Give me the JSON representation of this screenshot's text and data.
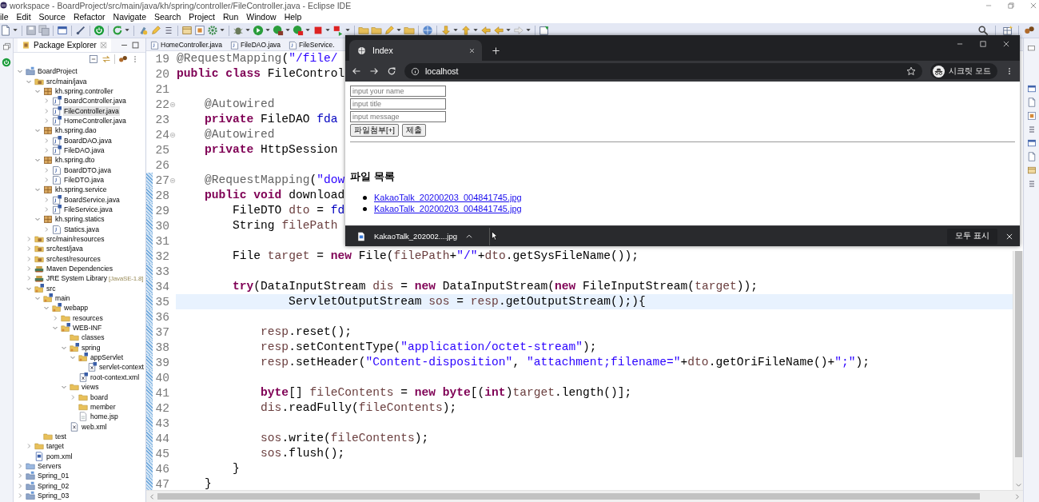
{
  "window": {
    "title": "workspace - BoardProject/src/main/java/kh/spring/controller/FileController.java - Eclipse IDE"
  },
  "menu": [
    "ile",
    "Edit",
    "Source",
    "Refactor",
    "Navigate",
    "Search",
    "Project",
    "Run",
    "Window",
    "Help"
  ],
  "package_explorer": {
    "title": "Package Explorer",
    "tree": [
      {
        "label": "BoardProject",
        "kind": "project",
        "expanded": true,
        "selected": false,
        "children": [
          {
            "label": "src/main/java",
            "kind": "source-folder",
            "expanded": true,
            "selected": false,
            "children": [
              {
                "label": "kh.spring.controller",
                "kind": "package",
                "expanded": true,
                "selected": false,
                "children": [
                  {
                    "label": "BoardController.java",
                    "kind": "bean",
                    "expanded": false,
                    "selected": false
                  },
                  {
                    "label": "FileController.java",
                    "kind": "bean",
                    "expanded": false,
                    "selected": true
                  },
                  {
                    "label": "HomeController.java",
                    "kind": "bean",
                    "expanded": false,
                    "selected": false
                  }
                ]
              },
              {
                "label": "kh.spring.dao",
                "kind": "package",
                "expanded": true,
                "selected": false,
                "children": [
                  {
                    "label": "BoardDAO.java",
                    "kind": "bean",
                    "expanded": false,
                    "selected": false
                  },
                  {
                    "label": "FileDAO.java",
                    "kind": "bean",
                    "expanded": false,
                    "selected": false
                  }
                ]
              },
              {
                "label": "kh.spring.dto",
                "kind": "package",
                "expanded": true,
                "selected": false,
                "children": [
                  {
                    "label": "BoardDTO.java",
                    "kind": "java",
                    "expanded": false,
                    "selected": false
                  },
                  {
                    "label": "FileDTO.java",
                    "kind": "java",
                    "expanded": false,
                    "selected": false
                  }
                ]
              },
              {
                "label": "kh.spring.service",
                "kind": "package",
                "expanded": true,
                "selected": false,
                "children": [
                  {
                    "label": "BoardService.java",
                    "kind": "bean",
                    "expanded": false,
                    "selected": false
                  },
                  {
                    "label": "FileService.java",
                    "kind": "bean",
                    "expanded": false,
                    "selected": false
                  }
                ]
              },
              {
                "label": "kh.spring.statics",
                "kind": "package",
                "expanded": true,
                "selected": false,
                "children": [
                  {
                    "label": "Statics.java",
                    "kind": "java",
                    "expanded": false,
                    "selected": false
                  }
                ]
              }
            ]
          },
          {
            "label": "src/main/resources",
            "kind": "source-folder",
            "expanded": false,
            "selected": false
          },
          {
            "label": "src/test/java",
            "kind": "source-folder",
            "expanded": false,
            "selected": false
          },
          {
            "label": "src/test/resources",
            "kind": "source-folder",
            "expanded": false,
            "selected": false
          },
          {
            "label": "Maven Dependencies",
            "kind": "library",
            "expanded": false,
            "selected": false
          },
          {
            "label": "JRE System Library",
            "decoration": "[JavaSE-1.8]",
            "kind": "library",
            "expanded": false,
            "selected": false
          },
          {
            "label": "src",
            "kind": "spring-folder",
            "expanded": true,
            "selected": false,
            "children": [
              {
                "label": "main",
                "kind": "spring-folder",
                "expanded": true,
                "selected": false,
                "children": [
                  {
                    "label": "webapp",
                    "kind": "spring-folder",
                    "expanded": true,
                    "selected": false,
                    "children": [
                      {
                        "label": "resources",
                        "kind": "folder",
                        "expanded": false,
                        "selected": false
                      },
                      {
                        "label": "WEB-INF",
                        "kind": "spring-folder",
                        "expanded": true,
                        "selected": false,
                        "children": [
                          {
                            "label": "classes",
                            "kind": "folder",
                            "selected": false
                          },
                          {
                            "label": "spring",
                            "kind": "spring-folder",
                            "expanded": true,
                            "selected": false,
                            "children": [
                              {
                                "label": "appServlet",
                                "kind": "spring-folder",
                                "expanded": true,
                                "selected": false,
                                "children": [
                                  {
                                    "label": "servlet-context",
                                    "kind": "spring-xml",
                                    "selected": false
                                  }
                                ]
                              },
                              {
                                "label": "root-context.xml",
                                "kind": "spring-xml",
                                "selected": false
                              }
                            ]
                          },
                          {
                            "label": "views",
                            "kind": "folder",
                            "expanded": true,
                            "selected": false,
                            "children": [
                              {
                                "label": "board",
                                "kind": "folder",
                                "expanded": false,
                                "selected": false
                              },
                              {
                                "label": "member",
                                "kind": "folder",
                                "selected": false
                              },
                              {
                                "label": "home.jsp",
                                "kind": "jsp",
                                "selected": false
                              }
                            ]
                          },
                          {
                            "label": "web.xml",
                            "kind": "xml",
                            "selected": false
                          }
                        ]
                      }
                    ]
                  }
                ]
              },
              {
                "label": "test",
                "kind": "folder",
                "selected": false
              }
            ]
          },
          {
            "label": "target",
            "kind": "folder",
            "expanded": false,
            "selected": false
          },
          {
            "label": "pom.xml",
            "kind": "pom",
            "selected": false
          }
        ]
      },
      {
        "label": "Servers",
        "kind": "servers",
        "expanded": false,
        "selected": false
      },
      {
        "label": "Spring_01",
        "kind": "project",
        "expanded": false,
        "selected": false
      },
      {
        "label": "Spring_02",
        "kind": "project",
        "expanded": false,
        "selected": false
      },
      {
        "label": "Spring_03",
        "kind": "project",
        "expanded": false,
        "selected": false
      }
    ]
  },
  "editor": {
    "tabs": [
      {
        "label": "HomeController.java",
        "selected": false
      },
      {
        "label": "FileDAO.java",
        "selected": false
      },
      {
        "label": "FileService.",
        "selected": false
      }
    ],
    "lines": [
      {
        "number": "19",
        "tokens": [
          {
            "kind": "annotation",
            "text": "@RequestMapping"
          },
          {
            "kind": "plain",
            "text": "("
          },
          {
            "kind": "string",
            "text": "\"/file/"
          }
        ]
      },
      {
        "number": "20",
        "tokens": [
          {
            "kind": "keyword",
            "text": "public "
          },
          {
            "kind": "keyword",
            "text": "class "
          },
          {
            "kind": "plain",
            "text": "FileControl"
          }
        ]
      },
      {
        "number": "21"
      },
      {
        "number": "22",
        "folding": true,
        "tokens": [
          {
            "kind": "annotation",
            "text": "    @Autowired"
          }
        ]
      },
      {
        "number": "23",
        "tokens": [
          {
            "kind": "keyword",
            "text": "    private "
          },
          {
            "kind": "plain",
            "text": "FileDAO "
          },
          {
            "kind": "field",
            "text": "fda"
          }
        ]
      },
      {
        "number": "24",
        "folding": true,
        "tokens": [
          {
            "kind": "annotation",
            "text": "    @Autowired"
          }
        ]
      },
      {
        "number": "25",
        "tokens": [
          {
            "kind": "keyword",
            "text": "    private "
          },
          {
            "kind": "plain",
            "text": "HttpSession"
          }
        ]
      },
      {
        "number": "26"
      },
      {
        "number": "27",
        "changed": true,
        "folding": true,
        "tokens": [
          {
            "kind": "annotation",
            "text": "    @RequestMapping"
          },
          {
            "kind": "plain",
            "text": "("
          },
          {
            "kind": "string",
            "text": "\"dow"
          }
        ]
      },
      {
        "number": "28",
        "changed": true,
        "tokens": [
          {
            "kind": "keyword",
            "text": "    public "
          },
          {
            "kind": "keyword",
            "text": "void "
          },
          {
            "kind": "plain",
            "text": "download"
          }
        ]
      },
      {
        "number": "29",
        "changed": true,
        "tokens": [
          {
            "kind": "plain",
            "text": "        FileDTO "
          },
          {
            "kind": "local",
            "text": "dto"
          },
          {
            "kind": "plain",
            "text": " = "
          },
          {
            "kind": "field",
            "text": "fd"
          }
        ]
      },
      {
        "number": "30",
        "changed": true,
        "tokens": [
          {
            "kind": "plain",
            "text": "        String "
          },
          {
            "kind": "local",
            "text": "filePath"
          }
        ]
      },
      {
        "number": "31",
        "changed": true
      },
      {
        "number": "32",
        "changed": true,
        "tokens": [
          {
            "kind": "plain",
            "text": "        File "
          },
          {
            "kind": "local",
            "text": "target"
          },
          {
            "kind": "plain",
            "text": " = "
          },
          {
            "kind": "keyword",
            "text": "new"
          },
          {
            "kind": "plain",
            "text": " File("
          },
          {
            "kind": "local",
            "text": "filePath"
          },
          {
            "kind": "plain",
            "text": "+"
          },
          {
            "kind": "string",
            "text": "\"/\""
          },
          {
            "kind": "plain",
            "text": "+"
          },
          {
            "kind": "local",
            "text": "dto"
          },
          {
            "kind": "plain",
            "text": ".getSysFileName());"
          }
        ]
      },
      {
        "number": "33",
        "changed": true
      },
      {
        "number": "34",
        "changed": true,
        "tokens": [
          {
            "kind": "keyword",
            "text": "        try"
          },
          {
            "kind": "plain",
            "text": "(DataInputStream "
          },
          {
            "kind": "local",
            "text": "dis"
          },
          {
            "kind": "plain",
            "text": " = "
          },
          {
            "kind": "keyword",
            "text": "new"
          },
          {
            "kind": "plain",
            "text": " DataInputStream("
          },
          {
            "kind": "keyword",
            "text": "new"
          },
          {
            "kind": "plain",
            "text": " FileInputStream("
          },
          {
            "kind": "local",
            "text": "target"
          },
          {
            "kind": "plain",
            "text": "));"
          }
        ]
      },
      {
        "number": "35",
        "current": true,
        "changed": true,
        "tokens": [
          {
            "kind": "plain",
            "text": "                ServletOutputStream "
          },
          {
            "kind": "local",
            "text": "sos"
          },
          {
            "kind": "plain",
            "text": " = "
          },
          {
            "kind": "local",
            "text": "resp"
          },
          {
            "kind": "plain",
            "text": ".getOutputStream();){"
          }
        ]
      },
      {
        "number": "36",
        "changed": true
      },
      {
        "number": "37",
        "changed": true,
        "tokens": [
          {
            "kind": "local",
            "text": "            resp"
          },
          {
            "kind": "plain",
            "text": ".reset();"
          }
        ]
      },
      {
        "number": "38",
        "changed": true,
        "tokens": [
          {
            "kind": "local",
            "text": "            resp"
          },
          {
            "kind": "plain",
            "text": ".setContentType("
          },
          {
            "kind": "string",
            "text": "\"application/octet-stream\""
          },
          {
            "kind": "plain",
            "text": ");"
          }
        ]
      },
      {
        "number": "39",
        "changed": true,
        "tokens": [
          {
            "kind": "local",
            "text": "            resp"
          },
          {
            "kind": "plain",
            "text": ".setHeader("
          },
          {
            "kind": "string",
            "text": "\"Content-disposition\""
          },
          {
            "kind": "plain",
            "text": ", "
          },
          {
            "kind": "string",
            "text": "\"attachment;filename=\""
          },
          {
            "kind": "plain",
            "text": "+"
          },
          {
            "kind": "local",
            "text": "dto"
          },
          {
            "kind": "plain",
            "text": ".getOriFileName()+"
          },
          {
            "kind": "string",
            "text": "\";\""
          },
          {
            "kind": "plain",
            "text": ");"
          }
        ]
      },
      {
        "number": "40",
        "changed": true
      },
      {
        "number": "41",
        "changed": true,
        "tokens": [
          {
            "kind": "keyword",
            "text": "            byte"
          },
          {
            "kind": "plain",
            "text": "[] "
          },
          {
            "kind": "local",
            "text": "fileContents"
          },
          {
            "kind": "plain",
            "text": " = "
          },
          {
            "kind": "keyword",
            "text": "new byte"
          },
          {
            "kind": "plain",
            "text": "[("
          },
          {
            "kind": "keyword",
            "text": "int"
          },
          {
            "kind": "plain",
            "text": ")"
          },
          {
            "kind": "local",
            "text": "target"
          },
          {
            "kind": "plain",
            "text": ".length()];"
          }
        ]
      },
      {
        "number": "42",
        "changed": true,
        "tokens": [
          {
            "kind": "local",
            "text": "            dis"
          },
          {
            "kind": "plain",
            "text": ".readFully("
          },
          {
            "kind": "local",
            "text": "fileContents"
          },
          {
            "kind": "plain",
            "text": ");"
          }
        ]
      },
      {
        "number": "43",
        "changed": true
      },
      {
        "number": "44",
        "changed": true,
        "tokens": [
          {
            "kind": "local",
            "text": "            sos"
          },
          {
            "kind": "plain",
            "text": ".write("
          },
          {
            "kind": "local",
            "text": "fileContents"
          },
          {
            "kind": "plain",
            "text": ");"
          }
        ]
      },
      {
        "number": "45",
        "changed": true,
        "tokens": [
          {
            "kind": "local",
            "text": "            sos"
          },
          {
            "kind": "plain",
            "text": ".flush();"
          }
        ]
      },
      {
        "number": "46",
        "changed": true,
        "tokens": [
          {
            "kind": "plain",
            "text": "        }"
          }
        ]
      },
      {
        "number": "47",
        "changed": true,
        "tokens": [
          {
            "kind": "plain",
            "text": "    }"
          }
        ]
      }
    ]
  },
  "browser": {
    "tabs": [
      {
        "title": "Index",
        "selected": true
      }
    ],
    "address": "localhost",
    "profile": "시크릿 모드",
    "page": {
      "fields": [
        {
          "placeholder": "input your name"
        },
        {
          "placeholder": "input title"
        },
        {
          "placeholder": "input message"
        }
      ],
      "buttons": [
        "파일첨부[+]",
        "제출"
      ],
      "heading": "파일 목록",
      "files": [
        "KakaoTalk_20200203_004841745.jpg",
        "KakaoTalk_20200203_004841745.jpg"
      ]
    },
    "downloads": [
      {
        "name": "KakaoTalk_202002....jpg"
      }
    ],
    "show_all": "모두 표시"
  }
}
